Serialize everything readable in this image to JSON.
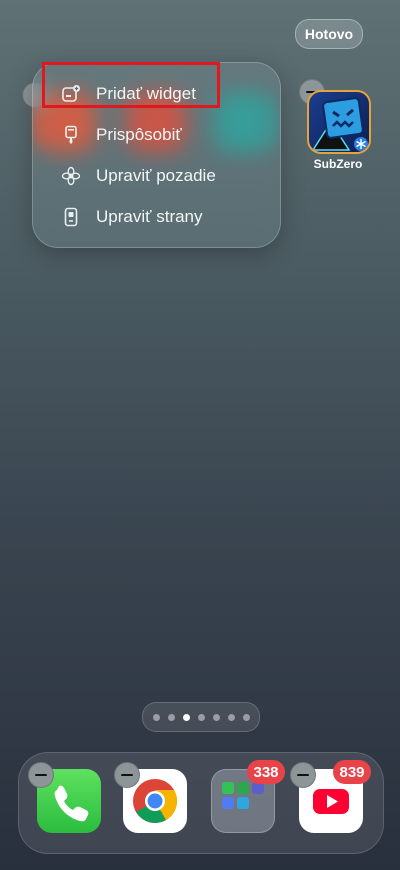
{
  "header": {
    "done_label": "Hotovo"
  },
  "menu": {
    "items": [
      {
        "label": "Pridať widget",
        "icon": "add-widget-icon"
      },
      {
        "label": "Prispôsobiť",
        "icon": "customize-brush-icon"
      },
      {
        "label": "Upraviť pozadie",
        "icon": "wallpaper-flower-icon"
      },
      {
        "label": "Upraviť strany",
        "icon": "pages-icon"
      }
    ]
  },
  "apps": {
    "subzero": {
      "label": "SubZero"
    }
  },
  "pages": {
    "count": 7,
    "active_index": 2
  },
  "dock": {
    "apps": [
      {
        "name": "Phone",
        "icon": "phone-icon"
      },
      {
        "name": "Chrome",
        "icon": "chrome-icon"
      },
      {
        "name": "Folder",
        "icon": "folder-icon",
        "badge": "338"
      },
      {
        "name": "YouTube",
        "icon": "youtube-icon",
        "badge": "839"
      }
    ]
  },
  "colors": {
    "badge": "#e9434a",
    "highlight": "#e1191f"
  }
}
